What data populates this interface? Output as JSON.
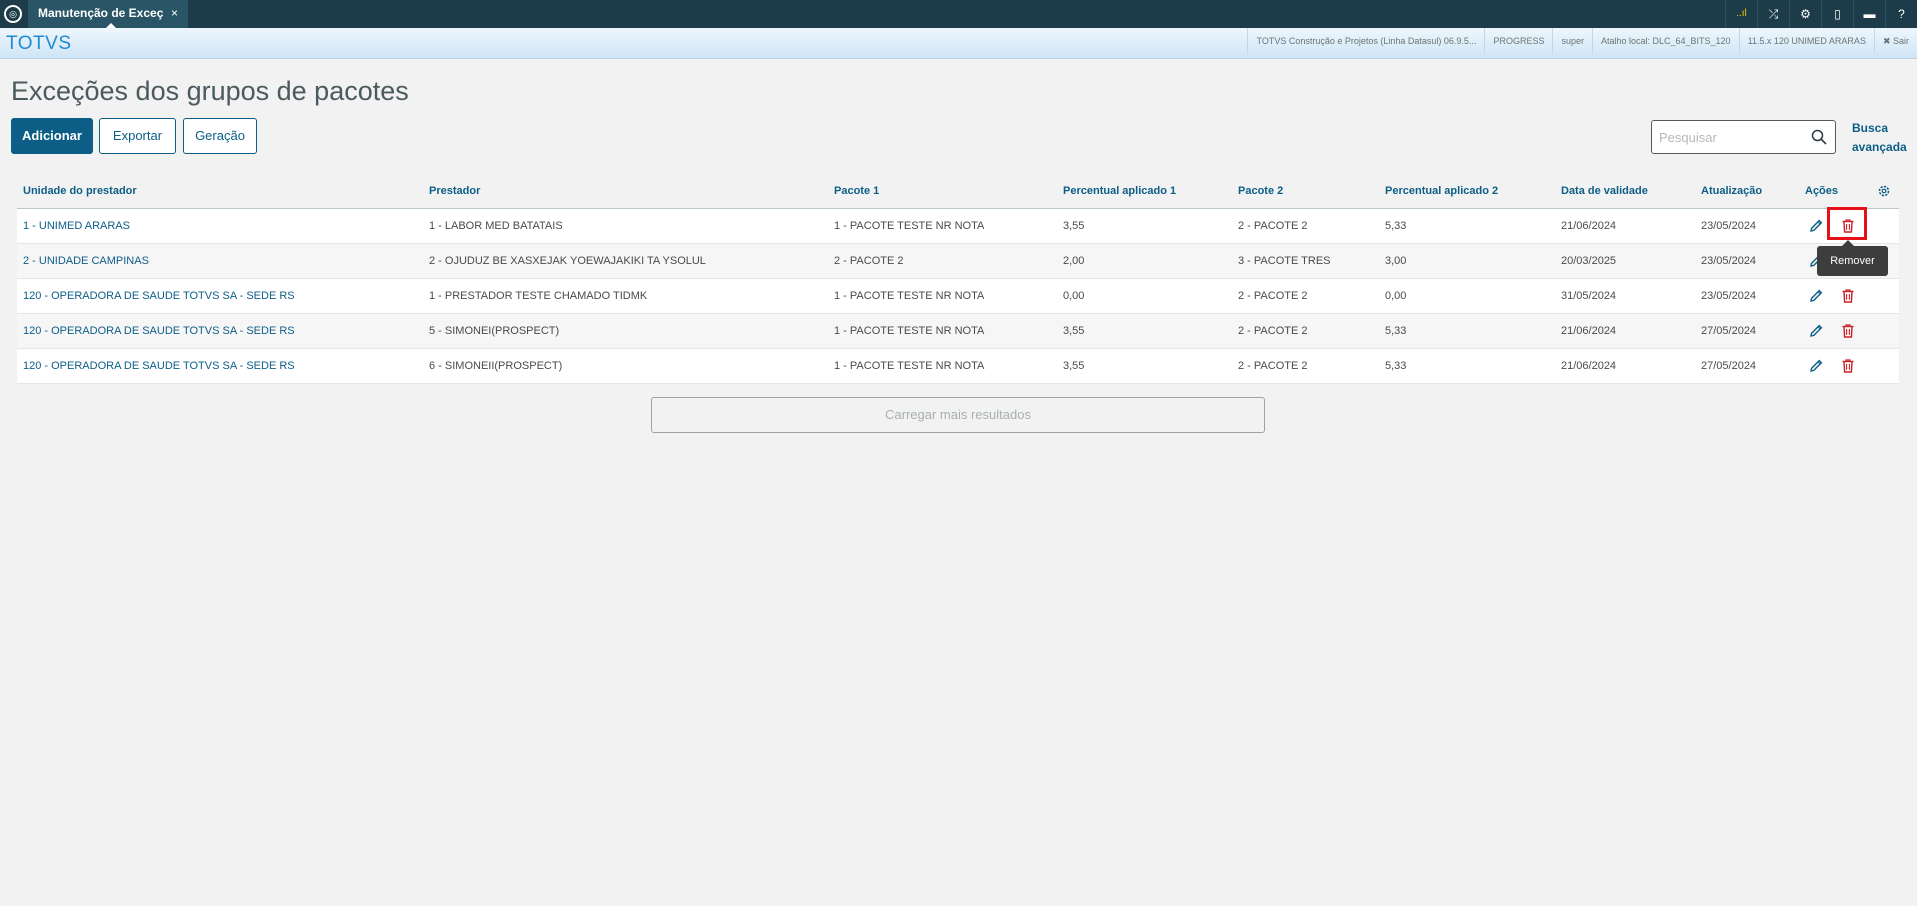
{
  "topbar": {
    "tab_title": "Manutenção de Exceç",
    "tab_close": "×",
    "signal_label": "..ıl",
    "icons": [
      "signal-icon",
      "shuffle-icon",
      "gear-icon",
      "document-icon",
      "chat-icon",
      "help-icon"
    ]
  },
  "header": {
    "brand": "TOTVS",
    "info": [
      "TOTVS Construção e Projetos (Linha Datasul) 06.9.5...",
      "PROGRESS",
      "super",
      "Atalho local: DLC_64_BITS_120",
      "11.5.x 120 UNIMED ARARAS"
    ],
    "logout": "✖ Sair"
  },
  "page": {
    "title": "Exceções dos grupos de pacotes",
    "buttons": {
      "add": "Adicionar",
      "export": "Exportar",
      "generate": "Geração"
    },
    "search_placeholder": "Pesquisar",
    "advanced_search": "Busca avançada"
  },
  "table": {
    "columns": [
      "Unidade do prestador",
      "Prestador",
      "Pacote 1",
      "Percentual aplicado 1",
      "Pacote 2",
      "Percentual aplicado 2",
      "Data de validade",
      "Atualização",
      "Ações"
    ],
    "rows": [
      [
        "1 - UNIMED ARARAS",
        "1 - LABOR MED BATATAIS",
        "1 - PACOTE TESTE NR NOTA",
        "3,55",
        "2 - PACOTE 2",
        "5,33",
        "21/06/2024",
        "23/05/2024"
      ],
      [
        "2 - UNIDADE CAMPINAS",
        "2 - OJUDUZ BE XASXEJAK YOEWAJAKIKI TA YSOLUL",
        "2 - PACOTE 2",
        "2,00",
        "3 - PACOTE TRES",
        "3,00",
        "20/03/2025",
        "23/05/2024"
      ],
      [
        "120 - OPERADORA DE SAUDE TOTVS SA - SEDE RS",
        "1 - PRESTADOR TESTE CHAMADO TIDMK",
        "1 - PACOTE TESTE NR NOTA",
        "0,00",
        "2 - PACOTE 2",
        "0,00",
        "31/05/2024",
        "23/05/2024"
      ],
      [
        "120 - OPERADORA DE SAUDE TOTVS SA - SEDE RS",
        "5 - SIMONEI(PROSPECT)",
        "1 - PACOTE TESTE NR NOTA",
        "3,55",
        "2 - PACOTE 2",
        "5,33",
        "21/06/2024",
        "27/05/2024"
      ],
      [
        "120 - OPERADORA DE SAUDE TOTVS SA - SEDE RS",
        "6 - SIMONEII(PROSPECT)",
        "1 - PACOTE TESTE NR NOTA",
        "3,55",
        "2 - PACOTE 2",
        "5,33",
        "21/06/2024",
        "27/05/2024"
      ]
    ],
    "tooltip": "Remover",
    "load_more": "Carregar mais resultados"
  },
  "colors": {
    "primary": "#0c5e87",
    "topbar": "#1c3c4a",
    "highlight": "#e41218",
    "delete_icon": "#c8202a"
  }
}
